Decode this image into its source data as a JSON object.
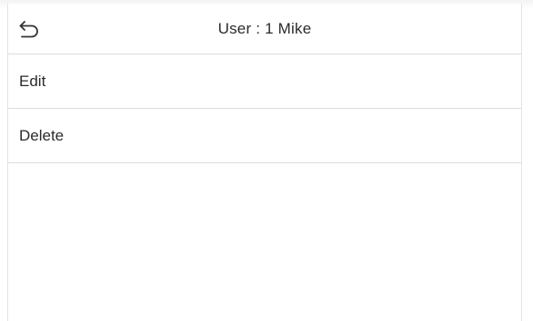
{
  "header": {
    "title": "User : 1 Mike",
    "back_icon": "back-arrow-icon"
  },
  "menu": {
    "items": [
      {
        "label": "Edit"
      },
      {
        "label": "Delete"
      }
    ]
  }
}
